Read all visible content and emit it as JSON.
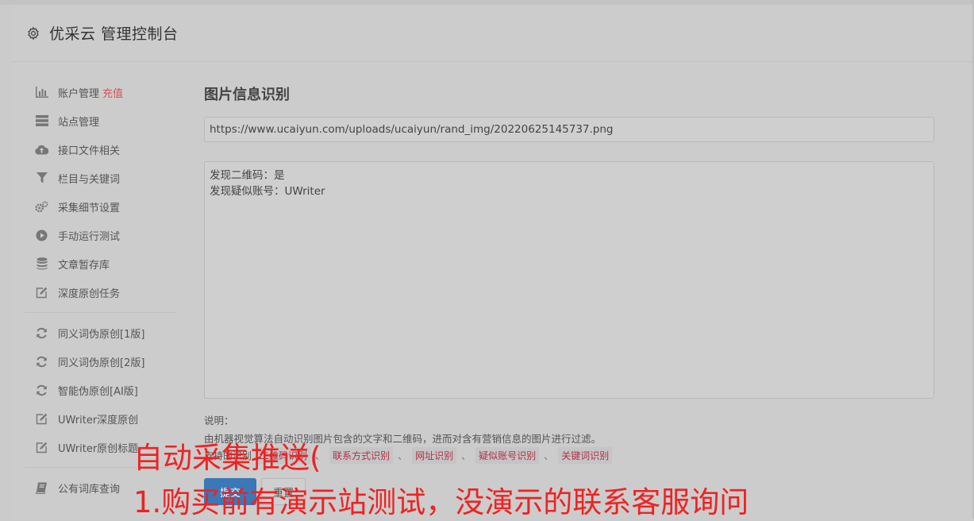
{
  "header": {
    "title": "优采云 管理控制台",
    "icon": "gear-icon"
  },
  "sidebar": {
    "group1": [
      {
        "label": "账户管理",
        "badge": "充值",
        "icon": "bar-chart-icon"
      },
      {
        "label": "站点管理",
        "icon": "server-icon"
      },
      {
        "label": "接口文件相关",
        "icon": "cloud-upload-icon"
      },
      {
        "label": "栏目与关键词",
        "icon": "filter-icon"
      },
      {
        "label": "采集细节设置",
        "icon": "gears-icon"
      },
      {
        "label": "手动运行测试",
        "icon": "play-circle-icon"
      },
      {
        "label": "文章暂存库",
        "icon": "database-icon"
      },
      {
        "label": "深度原创任务",
        "icon": "edit-icon"
      }
    ],
    "group2": [
      {
        "label": "同义词伪原创[1版]",
        "icon": "refresh-icon"
      },
      {
        "label": "同义词伪原创[2版]",
        "icon": "refresh-icon"
      },
      {
        "label": "智能伪原创[AI版]",
        "icon": "refresh-icon"
      },
      {
        "label": "UWriter深度原创",
        "icon": "edit-icon"
      },
      {
        "label": "UWriter原创标题",
        "icon": "edit-icon"
      }
    ],
    "group3": [
      {
        "label": "公有词库查询",
        "icon": "book-icon"
      }
    ]
  },
  "main": {
    "title": "图片信息识别",
    "url_value": "https://www.ucaiyun.com/uploads/ucaiyun/rand_img/20220625145737.png",
    "result_text": "发现二维码：是\n发现疑似账号：UWriter",
    "note_label": "说明：",
    "note_text": "由机器视觉算法自动识别图片包含的文字和二维码，进而对含有营销信息的图片进行过滤。",
    "tag_prefix": "支持的识别",
    "tags": [
      "二维码识别",
      "联系方式识别",
      "网址识别",
      "疑似账号识别",
      "关键词识别"
    ],
    "tag_separator": "、",
    "submit_label": "提交",
    "reset_label": "重置"
  },
  "overlay": {
    "line1": "自动采集推送(",
    "line2": "1.购买前有演示站测试，没演示的联系客服询问"
  }
}
